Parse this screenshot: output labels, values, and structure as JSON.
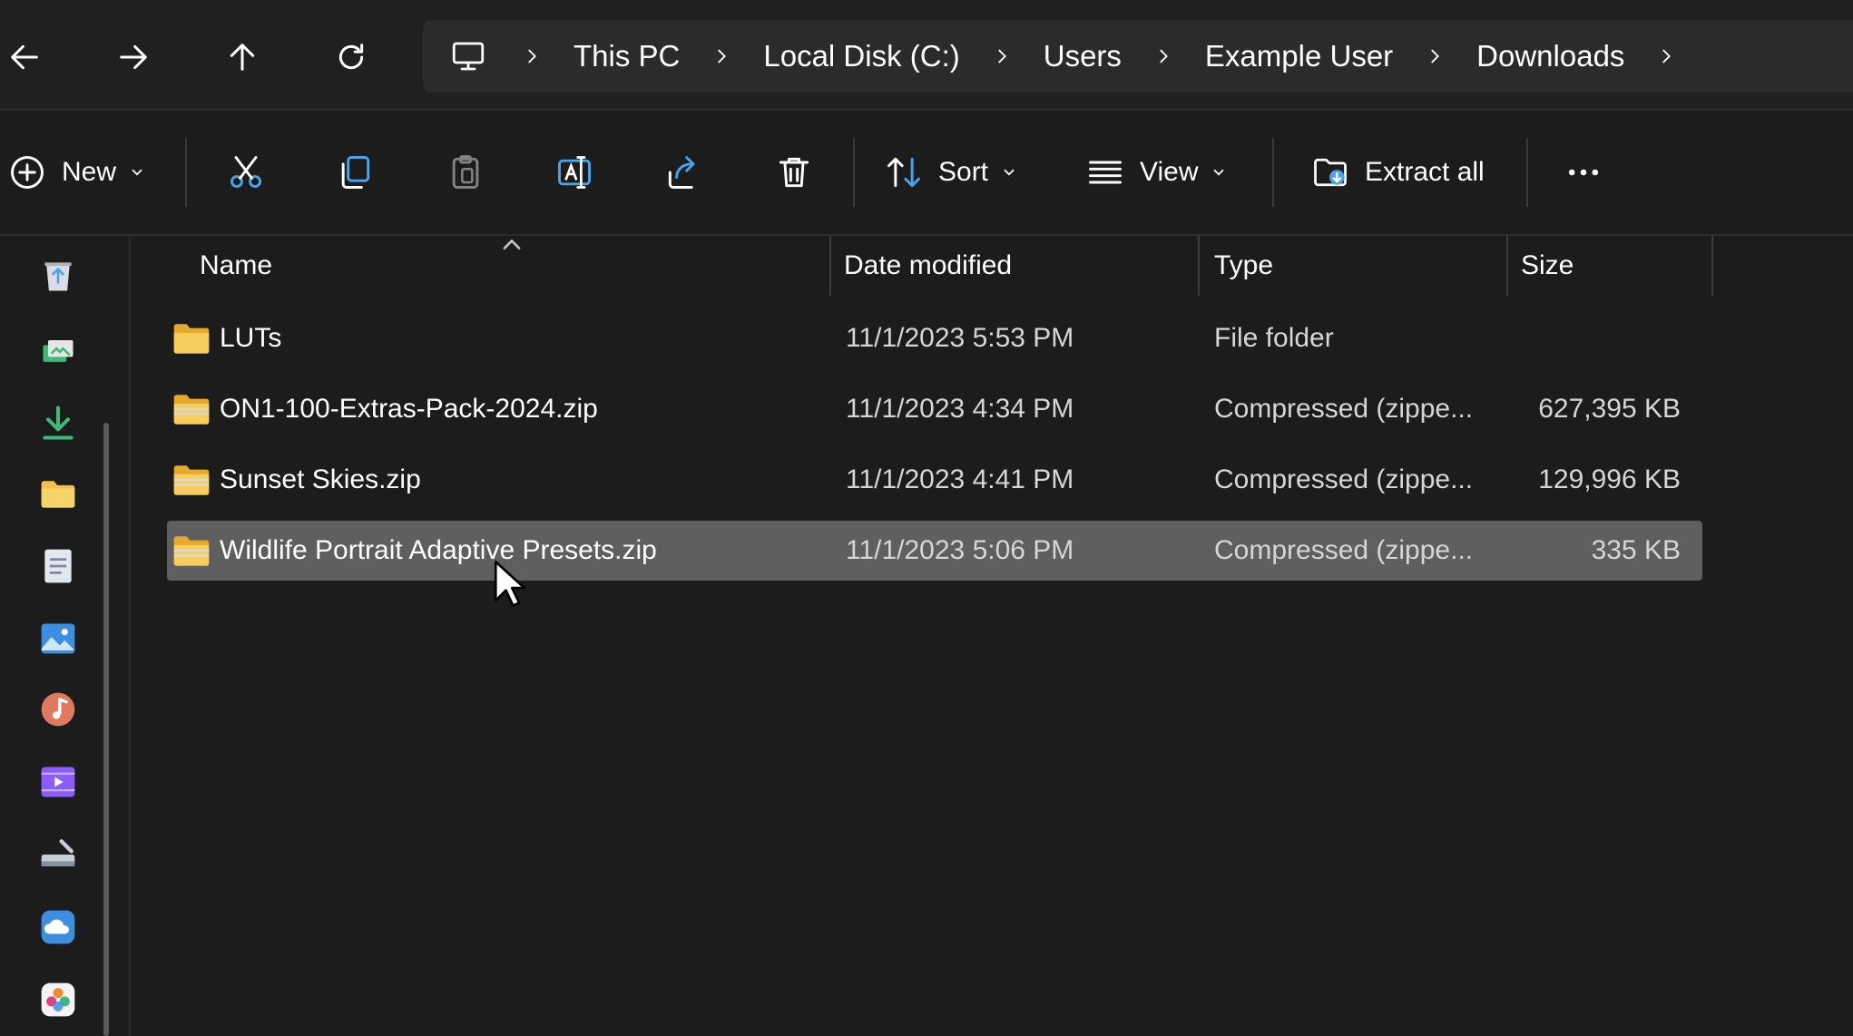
{
  "nav": {
    "back_icon": "arrow-left-icon",
    "forward_icon": "arrow-right-icon",
    "up_icon": "arrow-up-icon",
    "refresh_icon": "refresh-icon"
  },
  "breadcrumb": {
    "root_icon": "monitor-icon",
    "items": [
      "This PC",
      "Local Disk (C:)",
      "Users",
      "Example User",
      "Downloads"
    ]
  },
  "commands": {
    "new_label": "New",
    "sort_label": "Sort",
    "view_label": "View",
    "extract_label": "Extract all",
    "icons": [
      "plus-circle-icon",
      "cut-icon",
      "copy-icon",
      "paste-icon",
      "rename-icon",
      "share-icon",
      "delete-icon",
      "sort-icon",
      "view-list-icon",
      "extract-icon",
      "more-icon"
    ]
  },
  "sidebar": {
    "icons": [
      "recycle-bin-icon",
      "gallery-icon",
      "downloads-icon",
      "folder-icon",
      "documents-icon",
      "pictures-icon",
      "music-icon",
      "videos-icon",
      "drive-icon",
      "onedrive-icon",
      "photos-icon"
    ]
  },
  "columns": {
    "name": "Name",
    "date": "Date modified",
    "type": "Type",
    "size": "Size"
  },
  "files": [
    {
      "name": "LUTs",
      "date": "11/1/2023 5:53 PM",
      "type": "File folder",
      "size": "",
      "icon": "folder-icon"
    },
    {
      "name": "ON1-100-Extras-Pack-2024.zip",
      "date": "11/1/2023 4:34 PM",
      "type": "Compressed (zippe...",
      "size": "627,395 KB",
      "icon": "zip-folder-icon"
    },
    {
      "name": "Sunset Skies.zip",
      "date": "11/1/2023 4:41 PM",
      "type": "Compressed (zippe...",
      "size": "129,996 KB",
      "icon": "zip-folder-icon"
    },
    {
      "name": "Wildlife Portrait Adaptive Presets.zip",
      "date": "11/1/2023 5:06 PM",
      "type": "Compressed (zippe...",
      "size": "335 KB",
      "icon": "zip-folder-icon",
      "selected": true
    }
  ],
  "colors": {
    "background": "#1c1c1c",
    "selection": "#5f5f5f",
    "folder": "#f2c24b",
    "accent_blue": "#4aa3e8",
    "accent_green": "#3fb87a"
  }
}
